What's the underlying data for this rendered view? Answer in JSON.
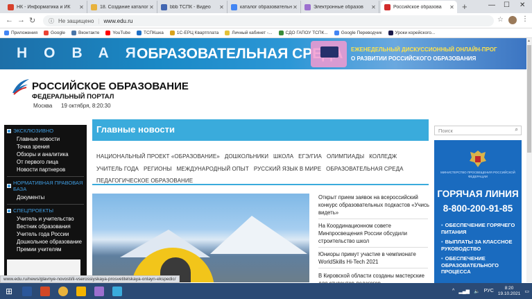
{
  "browser": {
    "tabs": [
      {
        "title": "НК - Информатика и ИК",
        "color": "#d7402b",
        "active": false
      },
      {
        "title": "18. Создание каталога",
        "color": "#e8b23c",
        "active": false
      },
      {
        "title": "bbb ТСПК - Видео",
        "color": "#4266b2",
        "active": false
      },
      {
        "title": "каталог образовательн",
        "color": "#4285f4",
        "active": false
      },
      {
        "title": "Электронные образов",
        "color": "#9c6fcf",
        "active": false
      },
      {
        "title": "Российское образова",
        "color": "#d22b2b",
        "active": true
      }
    ],
    "new_tab": "+",
    "address": {
      "security": "Не защищено",
      "url": "www.edu.ru"
    },
    "bookmarks": [
      {
        "label": "Приложения",
        "color": "#4285f4"
      },
      {
        "label": "Google",
        "color": "#ea4335"
      },
      {
        "label": "Вконтакте",
        "color": "#4a76a8"
      },
      {
        "label": "YouTube",
        "color": "#ff0000"
      },
      {
        "label": "ТСПКшка",
        "color": "#1f6fc5"
      },
      {
        "label": "1С-ЕРЦ Квартплата",
        "color": "#d9a21b"
      },
      {
        "label": "Личный кабинет -...",
        "color": "#e3c23a"
      },
      {
        "label": "СДО ГАПОУ ТСПК...",
        "color": "#3a8a3a"
      },
      {
        "label": "Google Переводчик",
        "color": "#4285f4"
      },
      {
        "label": "Уроки корейского...",
        "color": "#1a1a4a"
      }
    ]
  },
  "banner": {
    "word": "НОВАЯ",
    "title": "ОБРАЗОВАТЕЛЬНАЯ СРЕДА",
    "line1": "ЕЖЕНЕДЕЛЬНЫЙ ДИСКУССИОННЫЙ ОНЛАЙН-ПРОГ",
    "line2": "О РАЗВИТИИ РОССИЙСКОГО ОБРАЗОВАНИЯ"
  },
  "site": {
    "title": "РОССИЙСКОЕ ОБРАЗОВАНИЕ",
    "subtitle": "ФЕДЕРАЛЬНЫЙ ПОРТАЛ",
    "city": "Москва",
    "date": "19 октября, 8:20:30"
  },
  "sidebar": {
    "sections": [
      {
        "title": "ЭКСКЛЮЗИВНО",
        "links": [
          "Главные новости",
          "Точка зрения",
          "Обзоры и аналитика",
          "От первого лица",
          "Новости партнеров"
        ]
      },
      {
        "title": "НОРМАТИВНАЯ ПРАВОВАЯ БАЗА",
        "links": [
          "Документы"
        ]
      },
      {
        "title": "СПЕЦПРОЕКТЫ",
        "links": [
          "Учитель и учительство",
          "Вестник образования",
          "Учитель года России",
          "Дошкольное образование",
          "Премии учителям"
        ]
      }
    ]
  },
  "main": {
    "heading": "Главные новости",
    "categories": [
      "НАЦИОНАЛЬНЫЙ ПРОЕКТ «ОБРАЗОВАНИЕ»",
      "ДОШКОЛЬНИКИ",
      "ШКОЛА",
      "ЕГЭ/ГИА",
      "ОЛИМПИАДЫ",
      "КОЛЛЕДЖ",
      "УЧИТЕЛЬ ГОДА",
      "РЕГИОНЫ",
      "МЕЖДУНАРОДНЫЙ ОПЫТ",
      "РУССКИЙ ЯЗЫК В МИРЕ",
      "ОБРАЗОВАТЕЛЬНАЯ СРЕДА",
      "ПЕДАГОГИЧЕСКОЕ ОБРАЗОВАНИЕ"
    ],
    "news": [
      "Открыт прием заявок на всероссийский конкурс образовательных подкастов «Учись видеть»",
      "На Координационном совете Минпросвещения России обсудили строительство школ",
      "Юниоры примут участие в чемпионате WorldSkills Hi-Tech 2021",
      "В Кировской области созданы мастерские для студентов-педагогов"
    ]
  },
  "right": {
    "search_placeholder": "Поиск",
    "ministry": "МИНИСТЕРСТВО ПРОСВЕЩЕНИЯ РОССИЙСКОЙ ФЕДЕРАЦИИ",
    "hotline_title": "ГОРЯЧАЯ ЛИНИЯ",
    "hotline_phone": "8-800-200-91-85",
    "items": [
      "ОБЕСПЕЧЕНИЕ ГОРЯЧЕГО ПИТАНИЯ",
      "ВЫПЛАТЫ ЗА КЛАССНОЕ РУКОВОДСТВО",
      "ОБЕСПЕЧЕНИЕ ОБРАЗОВАТЕЛЬНОГО ПРОЦЕССА"
    ]
  },
  "statusbar": "www.edu.ru/news/glavnye-novosti/ii-vserossiyskaya-prosvetitelskaya-onlayn-ekspedic/",
  "taskbar": {
    "lang": "РУС",
    "time": "8:20",
    "date": "19.10.2021",
    "apps": [
      {
        "color": "#2b579a"
      },
      {
        "color": "#d24726"
      },
      {
        "color": "#e8b23c"
      },
      {
        "color": "#f4b400"
      },
      {
        "color": "#9c6fcf"
      },
      {
        "color": "#3aabdc"
      }
    ]
  }
}
